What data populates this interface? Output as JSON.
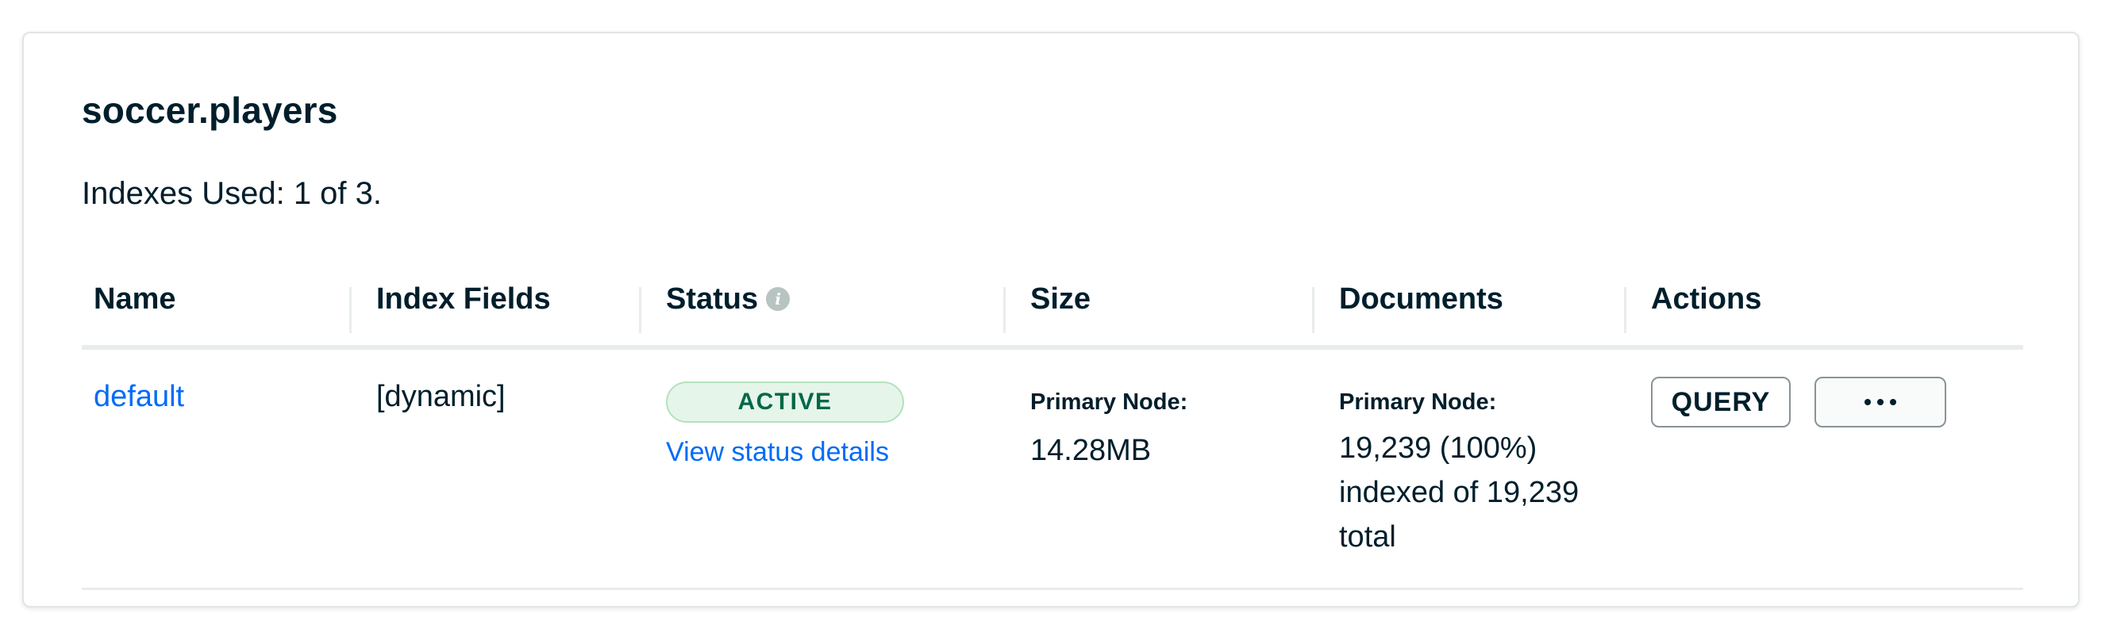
{
  "collection": {
    "title": "soccer.players",
    "indexes_used": "Indexes Used: 1 of 3."
  },
  "table": {
    "headers": {
      "name": "Name",
      "index_fields": "Index Fields",
      "status": "Status",
      "size": "Size",
      "documents": "Documents",
      "actions": "Actions"
    },
    "rows": [
      {
        "name": "default",
        "index_fields": "[dynamic]",
        "status_badge": "ACTIVE",
        "status_link": "View status details",
        "size_label": "Primary Node:",
        "size_value": "14.28MB",
        "documents_label": "Primary Node:",
        "documents_line1": "19,239 (100%)",
        "documents_line2": "indexed of 19,239",
        "documents_line3": "total",
        "query_button": "QUERY"
      }
    ]
  },
  "icons": {
    "status_info": "info-icon",
    "more": "ellipsis-icon"
  },
  "colors": {
    "link": "#016bf8",
    "badge_text": "#00684a",
    "badge_bg": "#e6f5e9",
    "text": "#001e2b"
  }
}
